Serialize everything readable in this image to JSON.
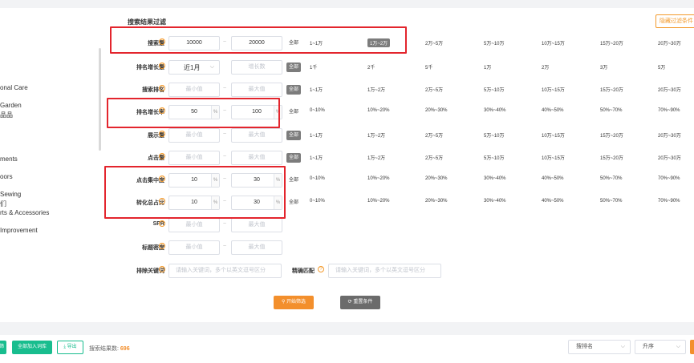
{
  "sidebar": {
    "items": [
      "onal Care",
      "Garden",
      "品品",
      "ments",
      "oors",
      "Sewing",
      "们",
      "rts & Accessories",
      "Improvement"
    ]
  },
  "filter": {
    "title": "搜索结果过滤",
    "hide_label": "隐藏过滤条件",
    "help_glyph": "?",
    "rows": {
      "search_volume": {
        "label": "搜索量",
        "min": "10000",
        "max": "20000",
        "all": "全部",
        "options": [
          "1~1万",
          "1万~2万",
          "2万~5万",
          "5万~10万",
          "10万~15万",
          "15万~20万",
          "20万~30万"
        ],
        "selected": "1万~2万"
      },
      "rank_growth": {
        "label": "排名增长量",
        "period": "近1月",
        "max_placeholder": "增长数",
        "all": "全部",
        "options": [
          "1千",
          "2千",
          "5千",
          "1万",
          "2万",
          "3万",
          "5万"
        ]
      },
      "search_rank": {
        "label": "搜索排名",
        "min_placeholder": "最小值",
        "max_placeholder": "最大值",
        "all": "全部",
        "options": [
          "1~1万",
          "1万~2万",
          "2万~5万",
          "5万~10万",
          "10万~15万",
          "15万~20万",
          "20万~30万"
        ]
      },
      "rank_growth_rate": {
        "label": "排名增长率",
        "min": "50",
        "max": "100",
        "unit": "%",
        "all": "全部",
        "options": [
          "0~10%",
          "10%~20%",
          "20%~30%",
          "30%~40%",
          "40%~50%",
          "50%~70%",
          "70%~90%"
        ]
      },
      "impressions": {
        "label": "展示量",
        "min_placeholder": "最小值",
        "max_placeholder": "最大值",
        "all": "全部",
        "options": [
          "1~1万",
          "1万~2万",
          "2万~5万",
          "5万~10万",
          "10万~15万",
          "15万~20万",
          "20万~30万"
        ]
      },
      "clicks": {
        "label": "点击量",
        "min_placeholder": "最小值",
        "max_placeholder": "最大值",
        "all": "全部",
        "options": [
          "1~1万",
          "1万~2万",
          "2万~5万",
          "5万~10万",
          "10万~15万",
          "15万~20万",
          "20万~30万"
        ]
      },
      "click_concentration": {
        "label": "点击集中度",
        "min": "10",
        "max": "30",
        "unit": "%",
        "all": "全部",
        "options": [
          "0~10%",
          "10%~20%",
          "20%~30%",
          "30%~40%",
          "40%~50%",
          "50%~70%",
          "70%~90%"
        ]
      },
      "conversion_share": {
        "label": "转化总占比",
        "min": "10",
        "max": "30",
        "unit": "%",
        "all": "全部",
        "options": [
          "0~10%",
          "10%~20%",
          "20%~30%",
          "30%~40%",
          "40%~50%",
          "50%~70%",
          "70%~90%"
        ]
      },
      "spr": {
        "label": "SPR",
        "min_placeholder": "最小值",
        "max_placeholder": "最大值"
      },
      "title_density": {
        "label": "标题密度",
        "min_placeholder": "最小值",
        "max_placeholder": "最大值"
      },
      "exclude_keywords": {
        "label": "排除关键词",
        "placeholder": "请输入关键词，多个以英文逗号区分"
      },
      "exact_match": {
        "label": "精确匹配",
        "placeholder": "请输入关键词，多个以英文逗号区分"
      }
    },
    "start_button": "开始筛选",
    "reset_button": "重置条件"
  },
  "bottom": {
    "btn1": "筛",
    "add_all": "全部加入词库",
    "export": "导出",
    "count_label": "搜索结果数:",
    "count_value": "696",
    "sort_field": "搜排名",
    "sort_order": "升序"
  },
  "colors": {
    "accent": "#f38f2c",
    "highlight": "#e3252d",
    "green": "#18bd8e",
    "selected": "#7c7c7c"
  }
}
